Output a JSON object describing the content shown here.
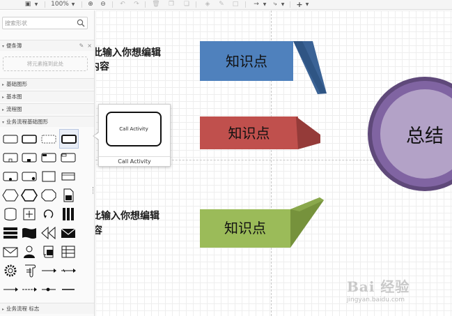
{
  "toolbar": {
    "zoom": "100%"
  },
  "sidebar": {
    "search_placeholder": "搜索形状",
    "scratchpad_title": "便条簿",
    "dropzone_text": "将元素拖到此处",
    "sections": [
      "基础图形",
      "基本图",
      "流程图",
      "业务流程基础图形"
    ],
    "bottom_section": "业务流程 标志"
  },
  "popup": {
    "shape_text": "Call Activity",
    "caption": "Call Activity"
  },
  "canvas": {
    "fragment_top_line1": "在此输入你想编辑",
    "fragment_top_line2": "的内容",
    "fragment_bottom_line1": "在此输入你想编辑",
    "fragment_bottom_line2": "的内容",
    "node_blue": "知识点",
    "node_red": "知识点",
    "node_green": "知识点",
    "summary": "总结"
  },
  "colors": {
    "blue": "#4f81bd",
    "red": "#c0504d",
    "green": "#9bbb59",
    "purple_outer": "#5f497a",
    "purple_mid": "#8064a2",
    "purple_inner": "#b3a2c7"
  },
  "watermark": {
    "brand": "Bai 经验",
    "url": "jingyan.baidu.com"
  }
}
